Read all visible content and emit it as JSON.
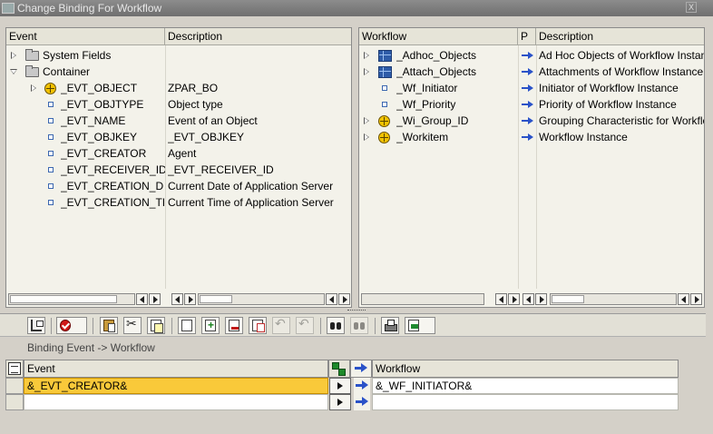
{
  "window": {
    "title": "Change Binding For Workflow",
    "close_label": "X"
  },
  "left_panel": {
    "columns": [
      "Event",
      "Description"
    ],
    "rows": [
      {
        "name": "System Fields",
        "desc": "",
        "icon": "folder-icon",
        "expander": "collapsed",
        "indent": 0
      },
      {
        "name": "Container",
        "desc": "",
        "icon": "folder-icon",
        "expander": "expanded",
        "indent": 0
      },
      {
        "name": "_EVT_OBJECT",
        "desc": "ZPAR_BO",
        "icon": "object-icon",
        "expander": "collapsed",
        "indent": 1
      },
      {
        "name": "_EVT_OBJTYPE",
        "desc": "Object type",
        "icon": "element-icon",
        "expander": "none",
        "indent": 1
      },
      {
        "name": "_EVT_NAME",
        "desc": "Event of an Object",
        "icon": "element-icon",
        "expander": "none",
        "indent": 1
      },
      {
        "name": "_EVT_OBJKEY",
        "desc": "_EVT_OBJKEY",
        "icon": "element-icon",
        "expander": "none",
        "indent": 1
      },
      {
        "name": "_EVT_CREATOR",
        "desc": "Agent",
        "icon": "element-icon",
        "expander": "none",
        "indent": 1
      },
      {
        "name": "_EVT_RECEIVER_ID",
        "desc": "_EVT_RECEIVER_ID",
        "icon": "element-icon",
        "expander": "none",
        "indent": 1
      },
      {
        "name": "_EVT_CREATION_D",
        "desc": "Current Date of Application Server",
        "icon": "element-icon",
        "expander": "none",
        "indent": 1
      },
      {
        "name": "_EVT_CREATION_TI",
        "desc": "Current Time of Application Server",
        "icon": "element-icon",
        "expander": "none",
        "indent": 1
      }
    ]
  },
  "right_panel": {
    "columns": [
      "Workflow",
      "P",
      "Description"
    ],
    "rows": [
      {
        "name": "_Adhoc_Objects",
        "desc": "Ad Hoc Objects of Workflow Instance",
        "icon": "table-icon",
        "expander": "collapsed"
      },
      {
        "name": "_Attach_Objects",
        "desc": "Attachments of Workflow Instance",
        "icon": "table-icon",
        "expander": "collapsed"
      },
      {
        "name": "_Wf_Initiator",
        "desc": "Initiator of Workflow Instance",
        "icon": "element-icon",
        "expander": "none"
      },
      {
        "name": "_Wf_Priority",
        "desc": "Priority of Workflow Instance",
        "icon": "element-icon",
        "expander": "none"
      },
      {
        "name": "_Wi_Group_ID",
        "desc": "Grouping Characteristic for Workflow",
        "icon": "object-icon",
        "expander": "collapsed"
      },
      {
        "name": "_Workitem",
        "desc": "Workflow Instance",
        "icon": "object-icon",
        "expander": "collapsed"
      }
    ]
  },
  "toolbar": {
    "buttons": [
      "tree-icon",
      "check-icon",
      "paste-icon",
      "cut-icon",
      "copy-icon",
      "new-page-icon",
      "insert-row-icon",
      "delete-row-icon",
      "duplicate-icon",
      "undo-icon",
      "redo-icon",
      "find-icon",
      "find-next-icon",
      "print-icon",
      "export-icon"
    ]
  },
  "binding": {
    "label": "Binding Event  -> Workflow",
    "columns": {
      "event": "Event",
      "workflow": "Workflow"
    },
    "rows": [
      {
        "event": "&_EVT_CREATOR&",
        "workflow": "&_WF_INITIATOR&"
      },
      {
        "event": "",
        "workflow": ""
      }
    ]
  }
}
